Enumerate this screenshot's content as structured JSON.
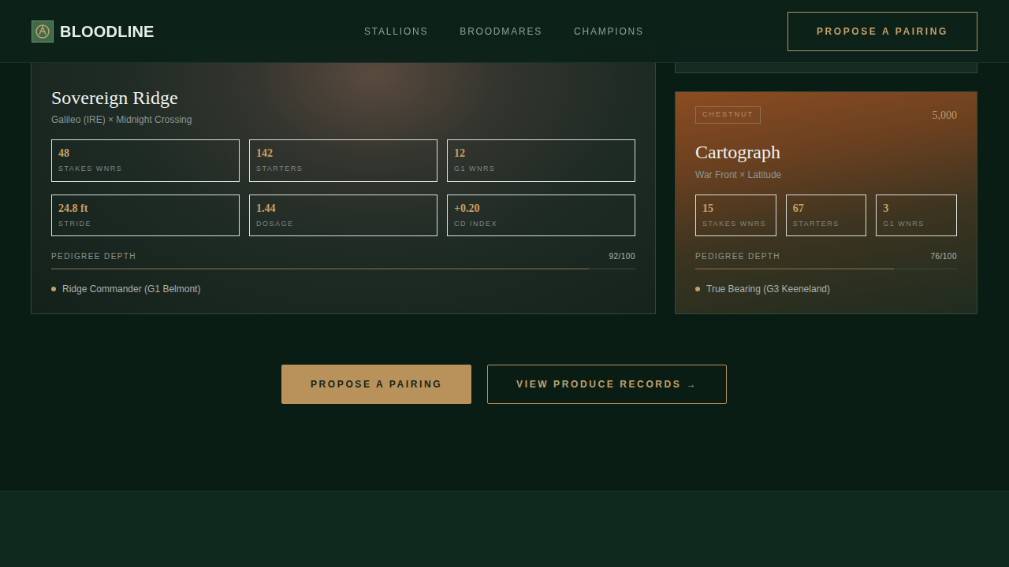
{
  "brand": {
    "name": "BLOODLINE"
  },
  "nav": {
    "links": [
      {
        "label": "STALLIONS"
      },
      {
        "label": "BROODMARES"
      },
      {
        "label": "CHAMPIONS"
      }
    ],
    "cta": "PROPOSE A PAIRING"
  },
  "stallions": [
    {
      "kind": "storm",
      "name": "Sovereign Ridge",
      "pedigree": "Galileo (IRE) × Midnight Crossing",
      "stats": [
        {
          "value": "48",
          "label": "STAKES WNRS"
        },
        {
          "value": "142",
          "label": "STARTERS"
        },
        {
          "value": "12",
          "label": "G1 WNRS"
        },
        {
          "value": "24.8 ft",
          "label": "STRIDE"
        },
        {
          "value": "1.44",
          "label": "DOSAGE"
        },
        {
          "value": "+0.20",
          "label": "CD INDEX"
        }
      ],
      "depth": {
        "label": "PEDIGREE DEPTH",
        "reading": "92/100",
        "level": 0.92
      },
      "notable": [
        "Ridge Commander (G1 Belmont)"
      ]
    },
    {
      "kind": "autumn",
      "coat": "CHESTNUT",
      "fee": "5,000",
      "name": "Cartograph",
      "pedigree": "War Front × Latitude",
      "stats": [
        {
          "value": "15",
          "label": "STAKES WNRS"
        },
        {
          "value": "67",
          "label": "STARTERS"
        },
        {
          "value": "3",
          "label": "G1 WNRS"
        }
      ],
      "depth": {
        "label": "PEDIGREE DEPTH",
        "reading": "76/100",
        "level": 0.76
      },
      "notable": [
        "True Bearing (G3 Keeneland)"
      ]
    }
  ],
  "actions": [
    {
      "label": "PROPOSE A PAIRING",
      "kind": "primary"
    },
    {
      "label": "VIEW PRODUCE RECORDS →",
      "kind": "outline"
    }
  ]
}
